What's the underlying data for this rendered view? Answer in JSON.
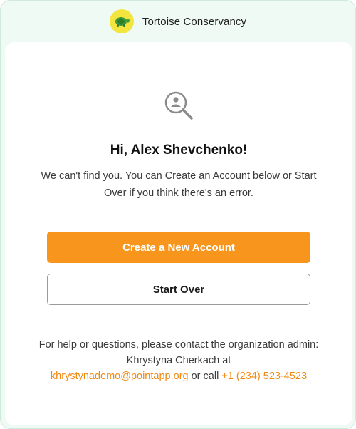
{
  "header": {
    "org_name": "Tortoise Conservancy",
    "logo_icon": "tortoise-icon",
    "logo_bg": "#f3e53d"
  },
  "main": {
    "icon": "search-person-icon",
    "greeting": "Hi, Alex Shevchenko!",
    "message": "We can't find you. You can Create an Account below or Start Over if you think there's an error.",
    "primary_button": "Create a New Account",
    "secondary_button": "Start Over"
  },
  "help": {
    "line1": "For help or questions, please contact the organization admin: Khrystyna Cherkach at",
    "email": "khrystynademo@pointapp.org",
    "or_call": " or call ",
    "phone": "+1 (234) 523-4523"
  },
  "colors": {
    "accent": "#f7951d",
    "link": "#f08a12",
    "frame_bg": "#f0faf5"
  }
}
